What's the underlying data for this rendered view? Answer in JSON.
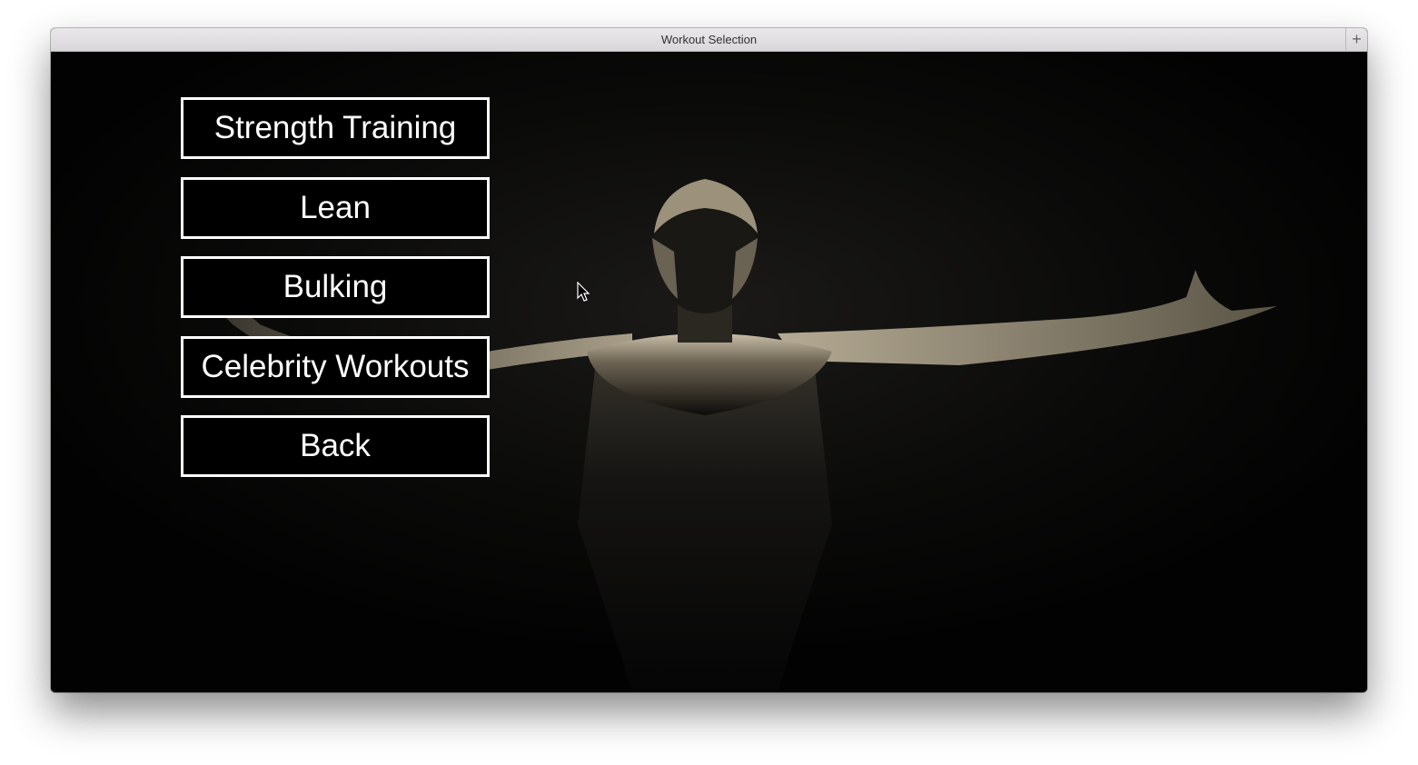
{
  "window": {
    "title": "Workout Selection",
    "add_tab_symbol": "+"
  },
  "background": {
    "icon": "muscular-man-arms-outstretched-photo"
  },
  "menu": {
    "buttons": [
      {
        "label": "Strength Training"
      },
      {
        "label": "Lean"
      },
      {
        "label": "Bulking"
      },
      {
        "label": "Celebrity Workouts"
      },
      {
        "label": "Back"
      }
    ]
  },
  "colors": {
    "button_border": "#ffffff",
    "button_background": "#000000",
    "button_text": "#ffffff",
    "background": "#020202"
  }
}
